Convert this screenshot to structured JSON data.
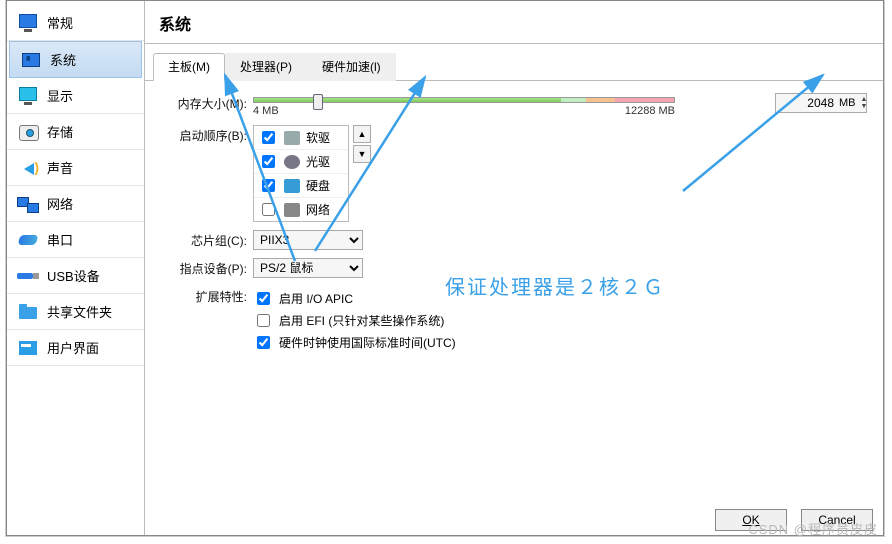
{
  "sidebar": {
    "items": [
      {
        "label": "常规",
        "icon": "monitor"
      },
      {
        "label": "系统",
        "icon": "chip",
        "selected": true
      },
      {
        "label": "显示",
        "icon": "display"
      },
      {
        "label": "存储",
        "icon": "disk"
      },
      {
        "label": "声音",
        "icon": "sound"
      },
      {
        "label": "网络",
        "icon": "net"
      },
      {
        "label": "串口",
        "icon": "serial"
      },
      {
        "label": "USB设备",
        "icon": "usb"
      },
      {
        "label": "共享文件夹",
        "icon": "folder"
      },
      {
        "label": "用户界面",
        "icon": "ui"
      }
    ]
  },
  "page_title": "系统",
  "tabs": [
    {
      "label": "主板(M)",
      "active": true
    },
    {
      "label": "处理器(P)"
    },
    {
      "label": "硬件加速(l)"
    }
  ],
  "memory": {
    "label": "内存大小(M):",
    "min_label": "4 MB",
    "max_label": "12288 MB",
    "value": "2048",
    "unit": "MB"
  },
  "boot_order": {
    "label": "启动顺序(B):",
    "items": [
      {
        "label": "软驱",
        "checked": true,
        "icon": "floppy"
      },
      {
        "label": "光驱",
        "checked": true,
        "icon": "disk"
      },
      {
        "label": "硬盘",
        "checked": true,
        "icon": "hd"
      },
      {
        "label": "网络",
        "checked": false,
        "icon": "net"
      }
    ]
  },
  "chipset": {
    "label": "芯片组(C):",
    "value": "PIIX3"
  },
  "pointing": {
    "label": "指点设备(P):",
    "value": "PS/2 鼠标"
  },
  "ext": {
    "label": "扩展特性:",
    "items": [
      {
        "label": "启用 I/O APIC",
        "checked": true
      },
      {
        "label": "启用 EFI (只针对某些操作系统)",
        "checked": false
      },
      {
        "label": "硬件时钟使用国际标准时间(UTC)",
        "checked": true
      }
    ]
  },
  "annotation": "保证处理器是２核２Ｇ",
  "buttons": {
    "ok": "OK",
    "cancel": "Cancel"
  },
  "watermark": "CSDN @程序员皮皮"
}
